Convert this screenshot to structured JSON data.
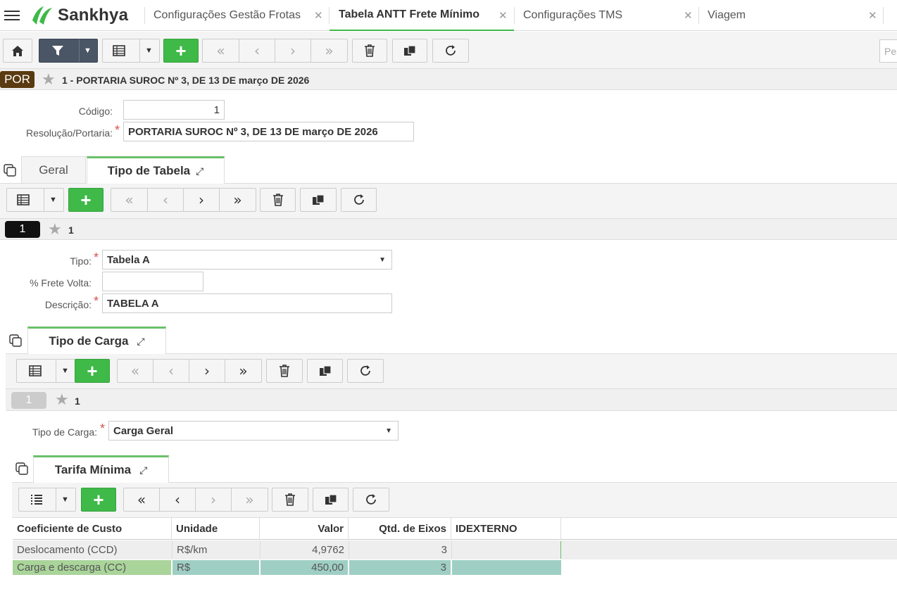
{
  "brand": {
    "name": "Sankhya"
  },
  "tabs": [
    {
      "label": "Configurações Gestão Frotas"
    },
    {
      "label": "Tabela ANTT Frete Mínimo"
    },
    {
      "label": "Configurações TMS"
    },
    {
      "label": "Viagem"
    }
  ],
  "search": {
    "placeholder": "Pes"
  },
  "record": {
    "badge": "POR",
    "title": "1 - PORTARIA SUROC Nº 3, DE 13 DE março DE 2026"
  },
  "form": {
    "codigo_label": "Código:",
    "codigo_value": "1",
    "resolucao_label": "Resolução/Portaria:",
    "resolucao_value": "PORTARIA SUROC Nº 3, DE 13 DE março DE 2026"
  },
  "subtabs": {
    "geral": "Geral",
    "tipo_tabela": "Tipo de Tabela"
  },
  "tipo_tabela": {
    "badge": "1",
    "title": "1",
    "tipo_label": "Tipo:",
    "tipo_value": "Tabela A",
    "frete_label": "% Frete Volta:",
    "frete_value": "",
    "descricao_label": "Descrição:",
    "descricao_value": "TABELA A"
  },
  "tipo_carga": {
    "tab": "Tipo de Carga",
    "badge": "1",
    "title": "1",
    "label": "Tipo de Carga:",
    "value": "Carga Geral"
  },
  "tarifa": {
    "tab": "Tarifa Mínima",
    "columns": [
      "Coeficiente de Custo",
      "Unidade",
      "Valor",
      "Qtd. de Eixos",
      "IDEXTERNO"
    ],
    "rows": [
      [
        "Deslocamento (CCD)",
        "R$/km",
        "4,9762",
        "3",
        ""
      ],
      [
        "Carga e descarga (CC)",
        "R$",
        "450,00",
        "3",
        ""
      ]
    ]
  },
  "icons": {
    "home": "home-icon",
    "filter": "filter-icon",
    "grid": "grid-icon",
    "add": "add-icon",
    "first": "first-icon",
    "prev": "prev-icon",
    "next": "next-icon",
    "last": "last-icon",
    "delete": "trash-icon",
    "copy": "copy-icon",
    "refresh": "refresh-icon"
  },
  "colors": {
    "green": "#3fb948",
    "badge_brown": "#5a3a10",
    "row_selected": "#9fcfc4",
    "row_selected_first": "#a9d49a"
  }
}
